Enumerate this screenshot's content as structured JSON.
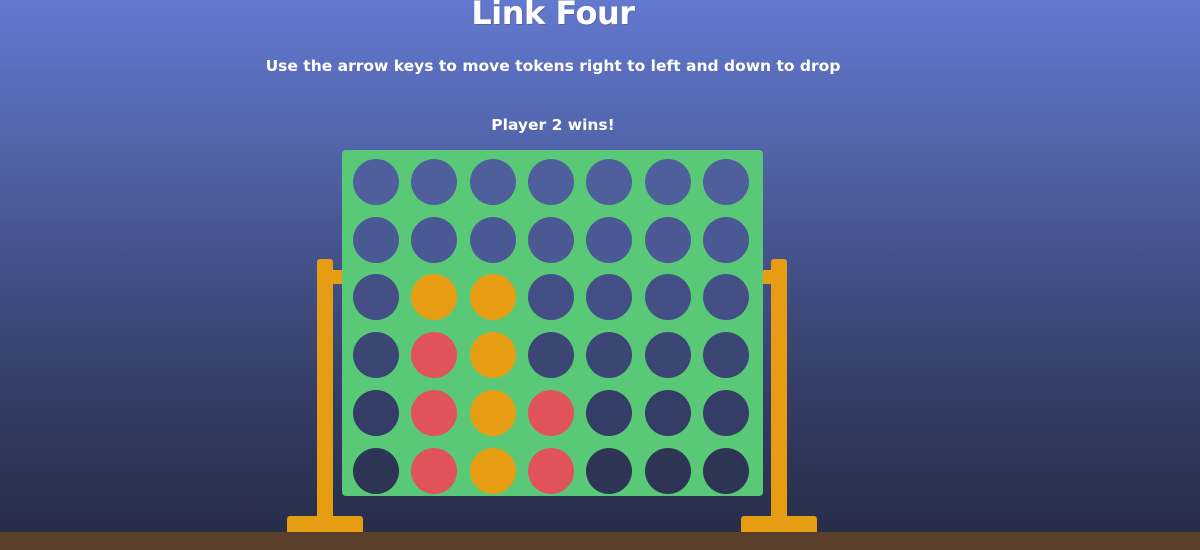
{
  "header": {
    "title": "Link Four",
    "instructions": "Use the arrow keys to move tokens right to left and down to drop",
    "status": "Player 2 wins!"
  },
  "colors": {
    "board": "#59c978",
    "player1_token": "#e0535a",
    "player2_token": "#e69d14",
    "stand": "#e69d14",
    "ground": "#5a3f2b"
  },
  "board": {
    "columns": 7,
    "rows": 6,
    "grid": [
      [
        0,
        0,
        0,
        0,
        0,
        0,
        0
      ],
      [
        0,
        0,
        0,
        0,
        0,
        0,
        0
      ],
      [
        0,
        2,
        2,
        0,
        0,
        0,
        0
      ],
      [
        0,
        1,
        2,
        0,
        0,
        0,
        0
      ],
      [
        0,
        1,
        2,
        1,
        0,
        0,
        0
      ],
      [
        0,
        1,
        2,
        1,
        0,
        0,
        0
      ]
    ]
  }
}
